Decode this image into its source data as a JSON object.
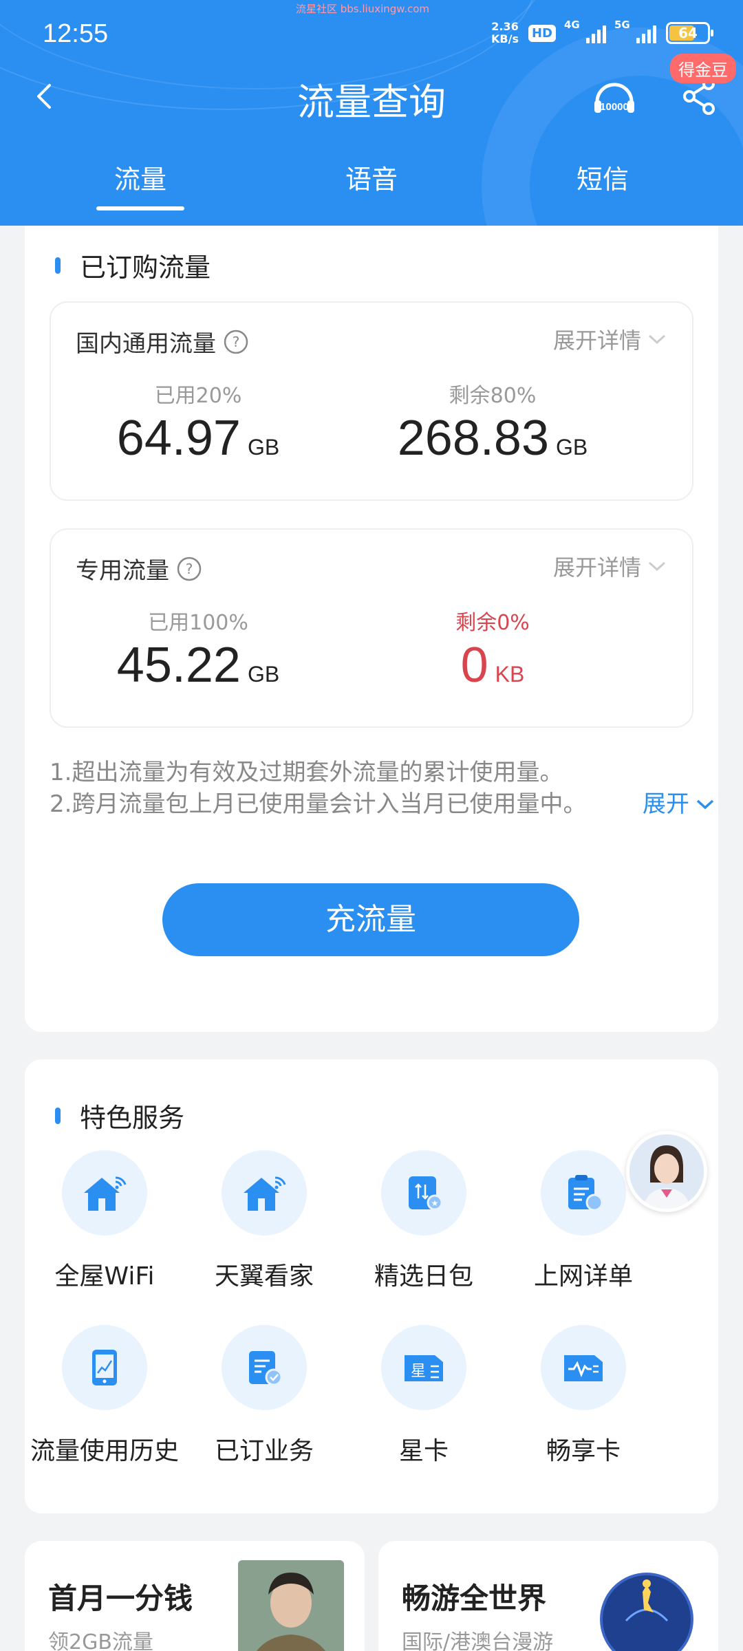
{
  "watermark": "流星社区 bbs.liuxingw.com",
  "status_bar": {
    "time": "12:55",
    "net_speed_value": "2.36",
    "net_speed_unit": "KB/s",
    "hd_label": "HD",
    "signal1_label": "4G",
    "signal2_label": "5G",
    "battery": "64"
  },
  "header": {
    "title": "流量查询",
    "gold_badge": "得金豆",
    "service_label": "10000"
  },
  "tabs": [
    {
      "label": "流量",
      "active": true
    },
    {
      "label": "语音",
      "active": false
    },
    {
      "label": "短信",
      "active": false
    }
  ],
  "subscribed": {
    "section_title": "已订购流量",
    "domestic": {
      "title": "国内通用流量",
      "expand_label": "展开详情",
      "used_label": "已用20%",
      "used_value": "64.97",
      "used_unit": "GB",
      "remain_label": "剩余80%",
      "remain_value": "268.83",
      "remain_unit": "GB"
    },
    "dedicated": {
      "title": "专用流量",
      "expand_label": "展开详情",
      "used_label": "已用100%",
      "used_value": "45.22",
      "used_unit": "GB",
      "remain_label": "剩余0%",
      "remain_value": "0",
      "remain_unit": "KB"
    },
    "notes": [
      "1.超出流量为有效及过期套外流量的累计使用量。",
      "2.跨月流量包上月已使用量会计入当月已使用量中。"
    ],
    "notes_more": "展开",
    "charge_button": "充流量"
  },
  "features": {
    "section_title": "特色服务",
    "items": [
      {
        "label": "全屋WiFi",
        "icon": "home-wifi-icon"
      },
      {
        "label": "天翼看家",
        "icon": "home-camera-icon"
      },
      {
        "label": "精选日包",
        "icon": "daily-pack-icon"
      },
      {
        "label": "上网详单",
        "icon": "usage-detail-icon"
      },
      {
        "label": "流量使用历史",
        "icon": "usage-history-icon"
      },
      {
        "label": "已订业务",
        "icon": "subscribed-business-icon"
      },
      {
        "label": "星卡",
        "icon": "star-card-icon"
      },
      {
        "label": "畅享卡",
        "icon": "enjoy-card-icon"
      }
    ]
  },
  "promos": [
    {
      "title": "首月一分钱",
      "subtitle": "领2GB流量"
    },
    {
      "title": "畅游全世界",
      "subtitle": "国际/港澳台漫游"
    }
  ]
}
